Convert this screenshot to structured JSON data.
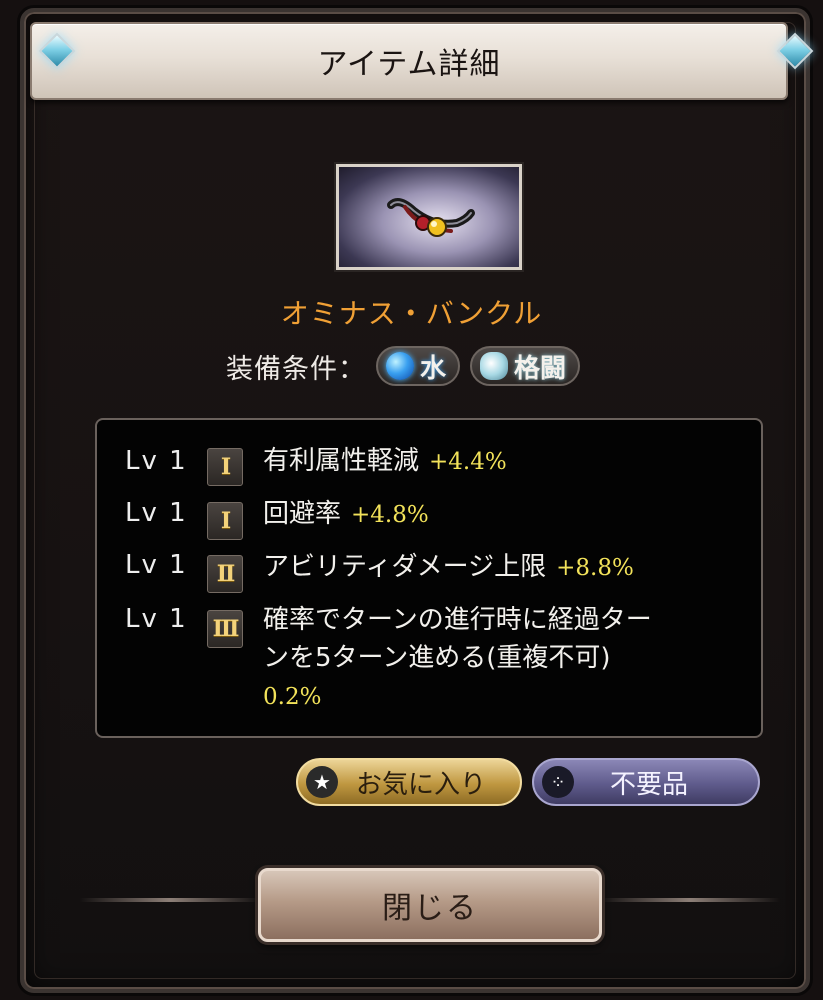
{
  "dialog": {
    "title": "アイテム詳細",
    "item_name": "オミナス・バンクル",
    "equip_condition_label": "装備条件：",
    "conditions": [
      {
        "icon": "water-element-icon",
        "label": "水"
      },
      {
        "icon": "fist-weapon-icon",
        "label": "格闘"
      }
    ],
    "skills": [
      {
        "level": "Lv 1",
        "tier": "I",
        "text": "有利属性軽減",
        "value": "+4.4%"
      },
      {
        "level": "Lv 1",
        "tier": "I",
        "text": "回避率",
        "value": "+4.8%"
      },
      {
        "level": "Lv 1",
        "tier": "II",
        "text": "アビリティダメージ上限",
        "value": "+8.8%"
      },
      {
        "level": "Lv 1",
        "tier": "III",
        "text_line1": "確率でターンの進行時に経過ター",
        "text_line2": "ンを5ターン進める(重複不可)",
        "value": "0.2%"
      }
    ],
    "buttons": {
      "favorite": "お気に入り",
      "unwanted": "不要品",
      "close": "閉じる"
    }
  },
  "colors": {
    "item_name": "#f0a035",
    "skill_value": "#f2e25a",
    "favorite_button": "#bf9740",
    "unwanted_button": "#5f5b8c"
  }
}
